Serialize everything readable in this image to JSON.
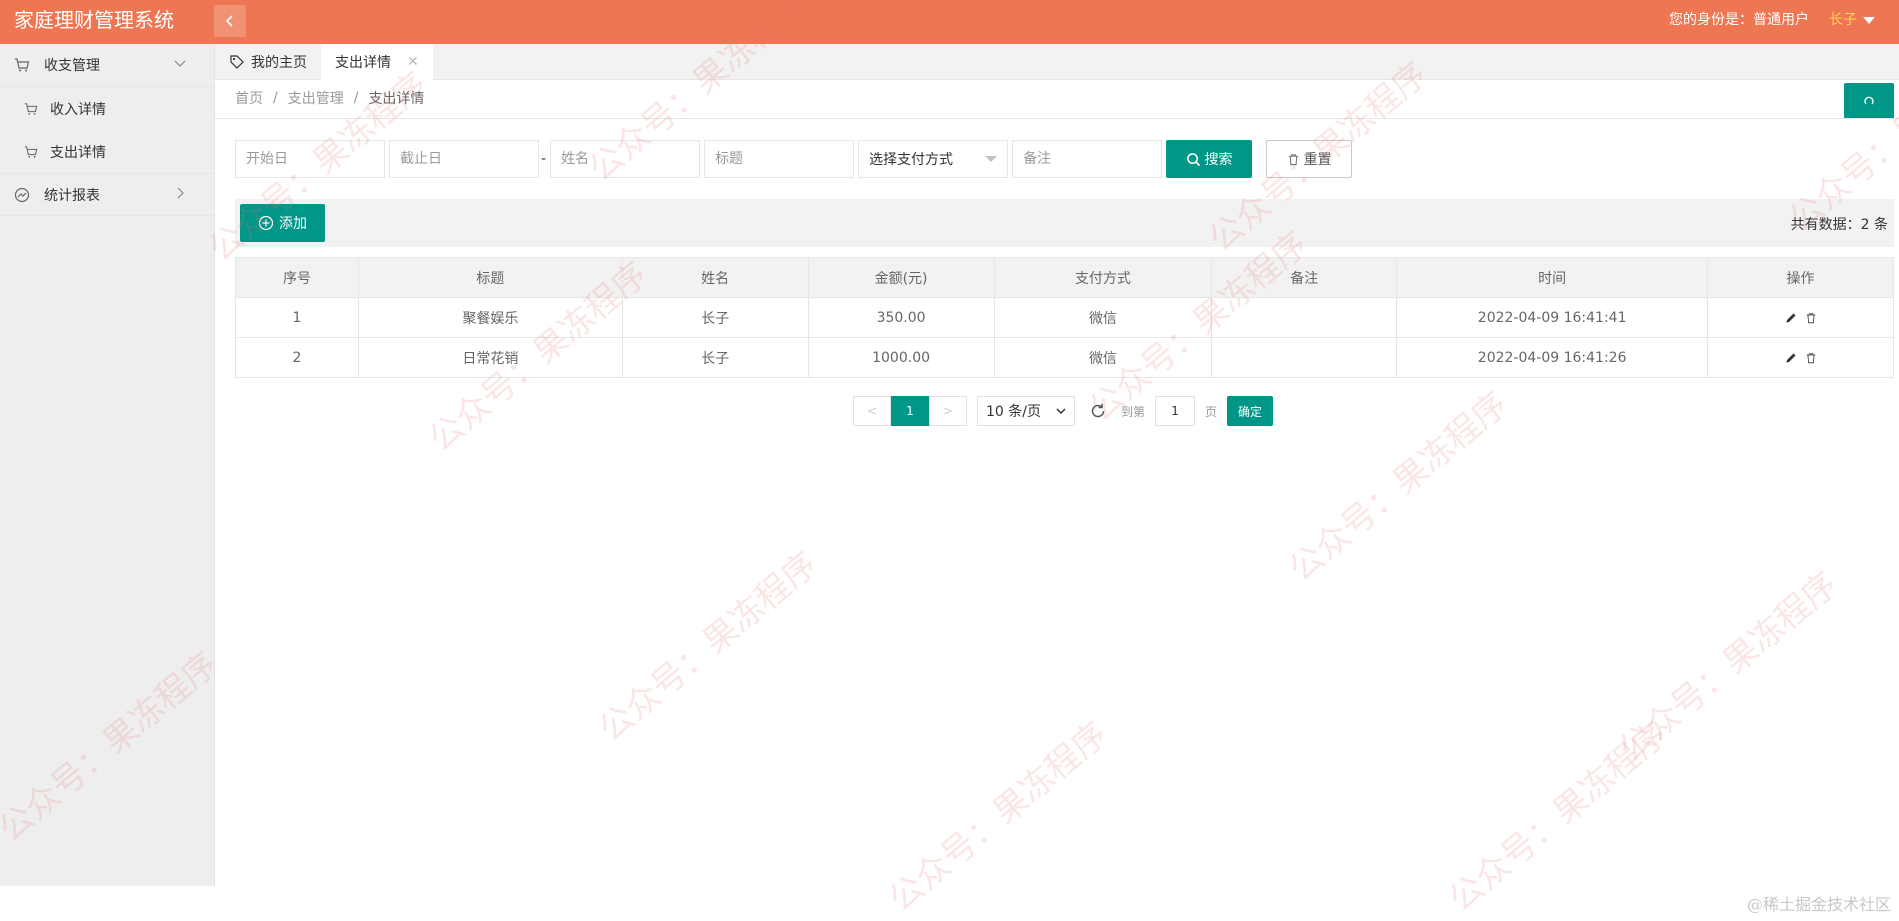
{
  "header": {
    "app_title": "家庭理财管理系统",
    "identity_label": "您的身份是：普通用户",
    "user_name": "长子"
  },
  "sidebar": {
    "groups": [
      {
        "label": "收支管理",
        "icon": "cart-icon",
        "expanded": true,
        "items": [
          {
            "label": "收入详情",
            "icon": "cart-icon"
          },
          {
            "label": "支出详情",
            "icon": "cart-icon"
          }
        ]
      },
      {
        "label": "统计报表",
        "icon": "chart-circle-icon",
        "expanded": false,
        "items": []
      }
    ]
  },
  "tabs": [
    {
      "label": "我的主页",
      "icon": "tag-icon",
      "active": false
    },
    {
      "label": "支出详情",
      "active": true,
      "closable": true
    }
  ],
  "breadcrumb": {
    "items": [
      "首页",
      "支出管理",
      "支出详情"
    ],
    "separator": "/"
  },
  "search": {
    "start_placeholder": "开始日",
    "end_placeholder": "截止日",
    "range_dash": "-",
    "name_placeholder": "姓名",
    "title_placeholder": "标题",
    "payment_select": "选择支付方式",
    "note_placeholder": "备注",
    "search_label": "搜索",
    "reset_label": "重置"
  },
  "toolbar": {
    "add_label": "添加",
    "total_text": "共有数据：2 条"
  },
  "table": {
    "columns": [
      "序号",
      "标题",
      "姓名",
      "金额(元)",
      "支付方式",
      "备注",
      "时间",
      "操作"
    ],
    "rows": [
      {
        "index": "1",
        "title": "聚餐娱乐",
        "name": "长子",
        "amount": "350.00",
        "payment": "微信",
        "note": "",
        "time": "2022-04-09 16:41:41"
      },
      {
        "index": "2",
        "title": "日常花销",
        "name": "长子",
        "amount": "1000.00",
        "payment": "微信",
        "note": "",
        "time": "2022-04-09 16:41:26"
      }
    ]
  },
  "pagination": {
    "prev": "<",
    "current_page": "1",
    "next": ">",
    "page_size": "10 条/页",
    "goto_label": "到第",
    "goto_value": "1",
    "page_unit": "页",
    "confirm_label": "确定"
  },
  "watermark": {
    "text": "公众号：果冻程序"
  },
  "footer": {
    "mark": "@稀土掘金技术社区"
  },
  "colors": {
    "header": "#ee7652",
    "accent": "#009688",
    "username": "#ffd45c"
  }
}
